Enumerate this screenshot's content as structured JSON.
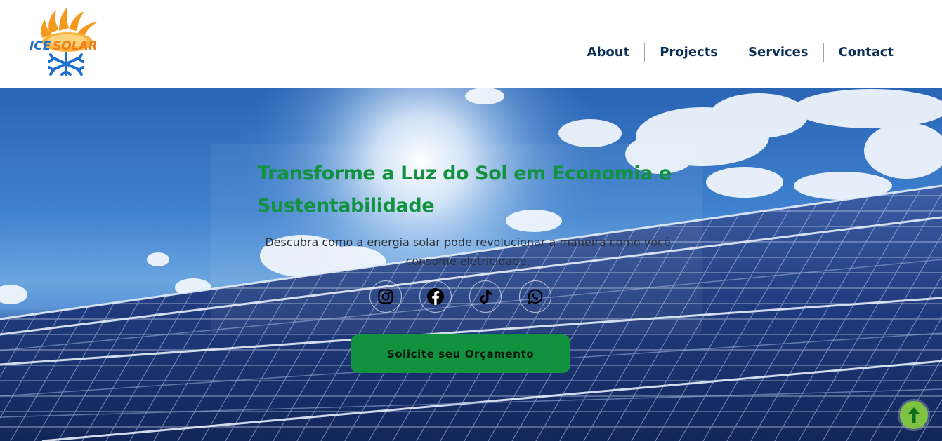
{
  "brand": {
    "logo_text_left": "ICE",
    "logo_text_right": "SOLAR",
    "logo_icon": "sun-snowflake-logo"
  },
  "nav": {
    "items": [
      {
        "label": "About"
      },
      {
        "label": "Projects"
      },
      {
        "label": "Services"
      },
      {
        "label": "Contact"
      }
    ]
  },
  "hero": {
    "title": "Transforme a Luz do Sol em Economia e Sustentabilidade",
    "subtitle": "Descubra como a energia solar pode revolucionar a maneira como você consome eletricidade.",
    "cta_label": "Solicite seu Orçamento",
    "socials": [
      {
        "icon": "instagram-icon"
      },
      {
        "icon": "facebook-icon"
      },
      {
        "icon": "tiktok-icon"
      },
      {
        "icon": "whatsapp-icon"
      }
    ]
  },
  "scroll_top": {
    "icon": "arrow-up-icon"
  },
  "colors": {
    "nav_text": "#0c2f55",
    "brand_green": "#12913e",
    "scroll_top_green": "#7dc242",
    "logo_orange": "#f39a1e",
    "logo_blue": "#1f6fd1"
  }
}
